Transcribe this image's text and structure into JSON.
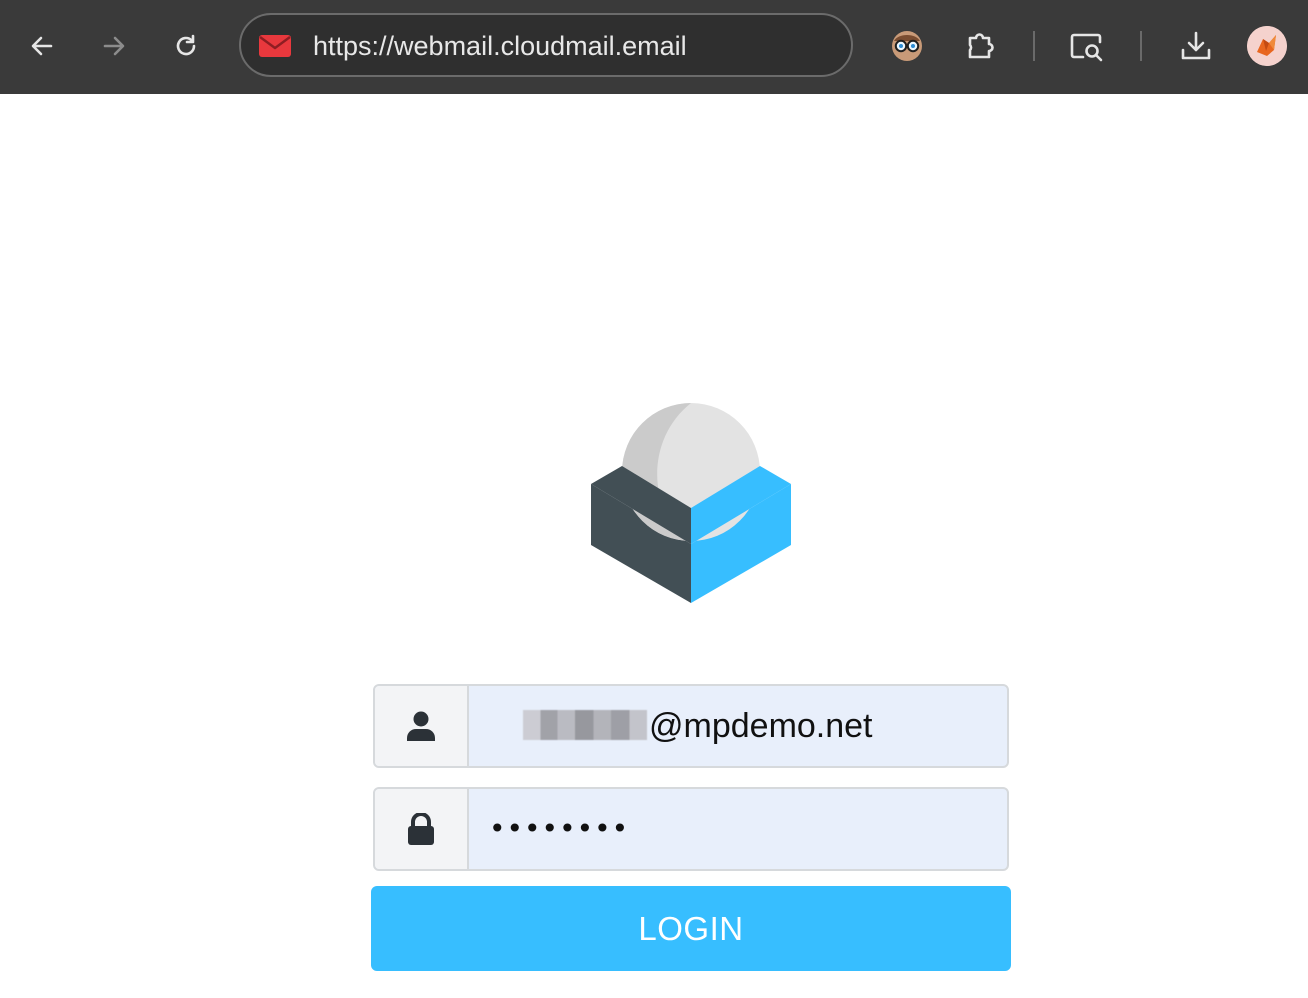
{
  "browser": {
    "url": "https://webmail.cloudmail.email",
    "icons": {
      "back": "arrow-left-icon",
      "forward": "arrow-right-icon",
      "reload": "reload-icon",
      "favicon": "mail-envelope-icon",
      "extension_1": "glasses-face-icon",
      "extensions": "puzzle-piece-icon",
      "screen_search": "screen-search-icon",
      "downloads": "download-icon",
      "profile": "profile-avatar-icon"
    },
    "colors": {
      "toolbar_bg": "#3a3a3a",
      "favicon": "#e8383d"
    }
  },
  "login": {
    "logo": "roundcube-logo",
    "username": {
      "icon": "user-icon",
      "value_suffix": "@mpdemo.net"
    },
    "password": {
      "icon": "lock-icon",
      "masked_value": "••••••••"
    },
    "login_button": "LOGIN",
    "colors": {
      "accent": "#37beff",
      "input_bg": "#e8effb",
      "addon_bg": "#f3f4f6",
      "logo_dark": "#424f55",
      "logo_sphere": "#e3e3e3"
    }
  }
}
